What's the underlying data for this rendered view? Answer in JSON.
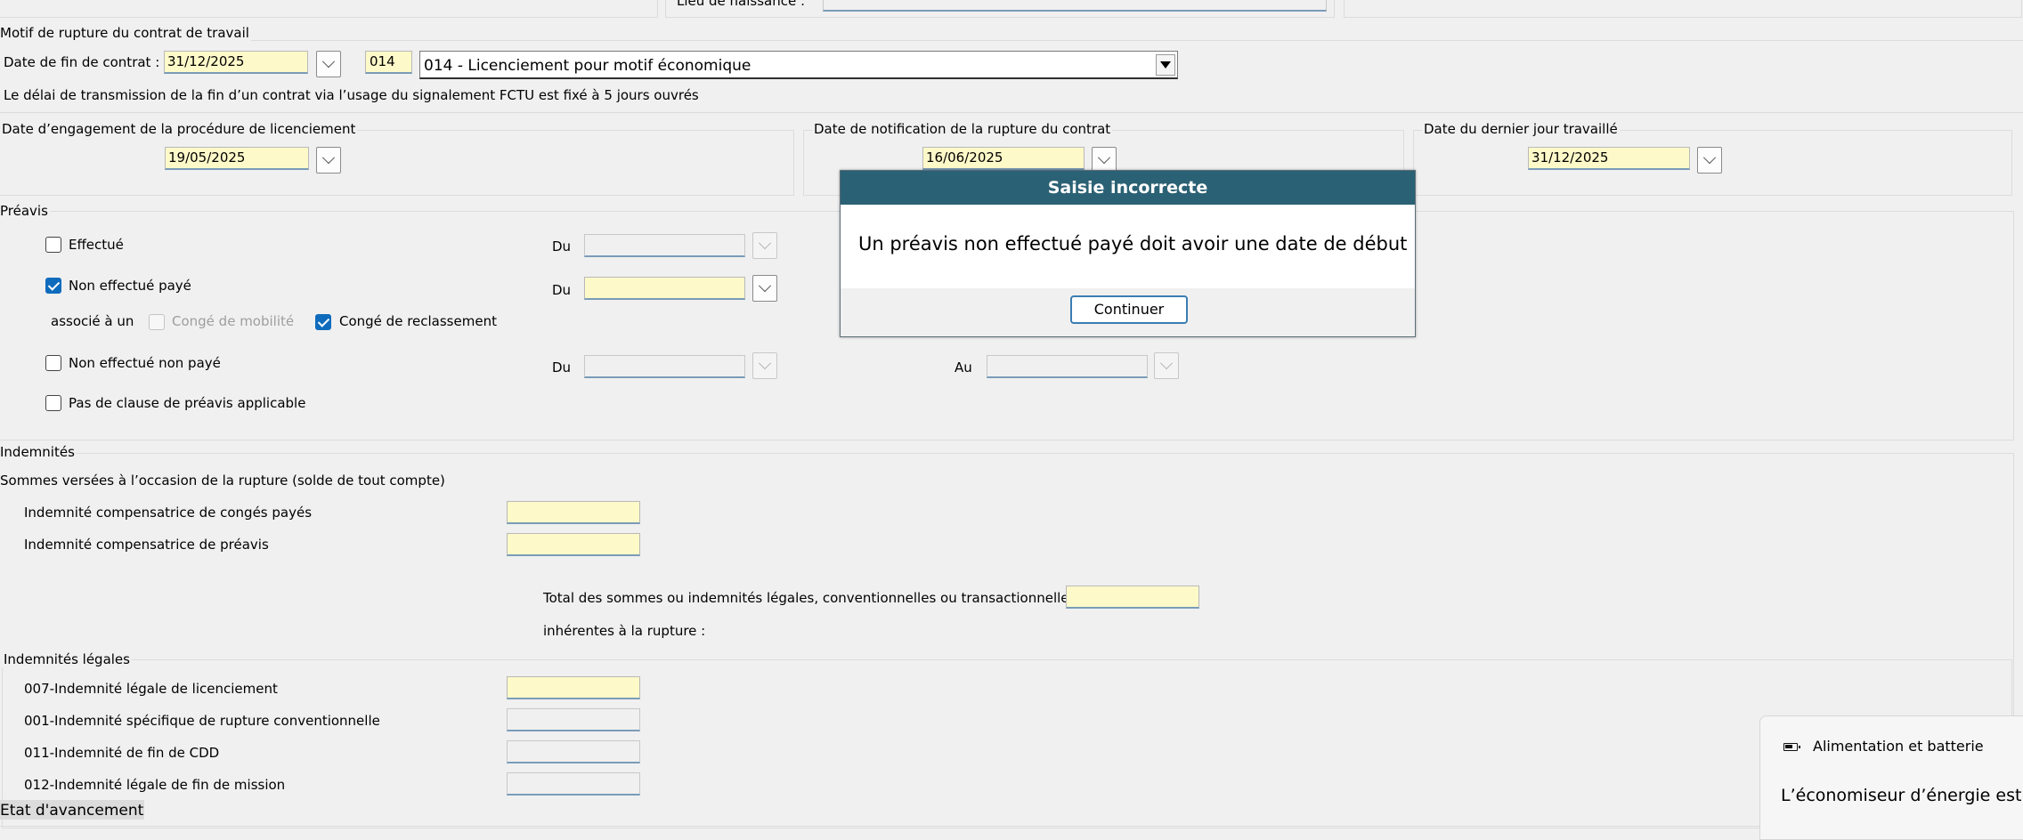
{
  "top": {
    "birthplace_label": "Lieu de naissance :"
  },
  "rupture": {
    "group_label": "Motif de rupture du contrat de travail",
    "end_date_label": "Date de fin de contrat :",
    "end_date_value": "31/12/2025",
    "code_value": "014",
    "motif_selected": "014 - Licenciement pour motif économique",
    "info_text": "Le délai de transmission de la fin d’un contrat via l’usage du signalement FCTU est fixé à 5 jours ouvrés"
  },
  "dates": {
    "engagement_label": "Date d’engagement de la procédure de licenciement",
    "engagement_value": "19/05/2025",
    "notification_label": "Date de notification de la rupture du contrat",
    "notification_value": "16/06/2025",
    "last_day_label": "Date du dernier jour travaillé",
    "last_day_value": "31/12/2025"
  },
  "preavis": {
    "group_label": "Préavis",
    "effectue_label": "Effectué",
    "effectue_checked": false,
    "non_effectue_paye_label": "Non effectué payé",
    "non_effectue_paye_checked": true,
    "associe_label": "associé à un",
    "conge_mobilite_label": "Congé de mobilité",
    "conge_mobilite_checked": false,
    "conge_reclassement_label": "Congé de reclassement",
    "conge_reclassement_checked": true,
    "non_effectue_non_paye_label": "Non effectué non payé",
    "non_effectue_non_paye_checked": false,
    "pas_clause_label": "Pas de clause de préavis applicable",
    "pas_clause_checked": false,
    "du_label": "Du",
    "au_label": "Au"
  },
  "indemnites": {
    "group_label": "Indemnités",
    "sommes_label": "Sommes versées à l’occasion de la rupture (solde de tout compte)",
    "conges_payes_label": "Indemnité compensatrice de congés payés",
    "preavis_label": "Indemnité compensatrice de préavis",
    "total_label_1": "Total des sommes ou indemnités légales, conventionnelles ou transactionnelles",
    "total_label_2": "inhérentes à la rupture :",
    "legales_group_label": "Indemnités légales",
    "items": [
      {
        "label": "007-Indemnité légale de licenciement"
      },
      {
        "label": "001-Indemnité spécifique de rupture conventionnelle"
      },
      {
        "label": "011-Indemnité de fin de CDD"
      },
      {
        "label": "012-Indemnité légale de fin de mission"
      }
    ]
  },
  "dialog": {
    "title": "Saisie incorrecte",
    "message": "Un préavis non effectué payé doit avoir une date de début",
    "button": "Continuer"
  },
  "status_bar": {
    "text": "Etat d'avancement"
  },
  "toast": {
    "icon": "battery-icon",
    "title": "Alimentation et batterie",
    "message": "L’économiseur d’énergie est a"
  }
}
